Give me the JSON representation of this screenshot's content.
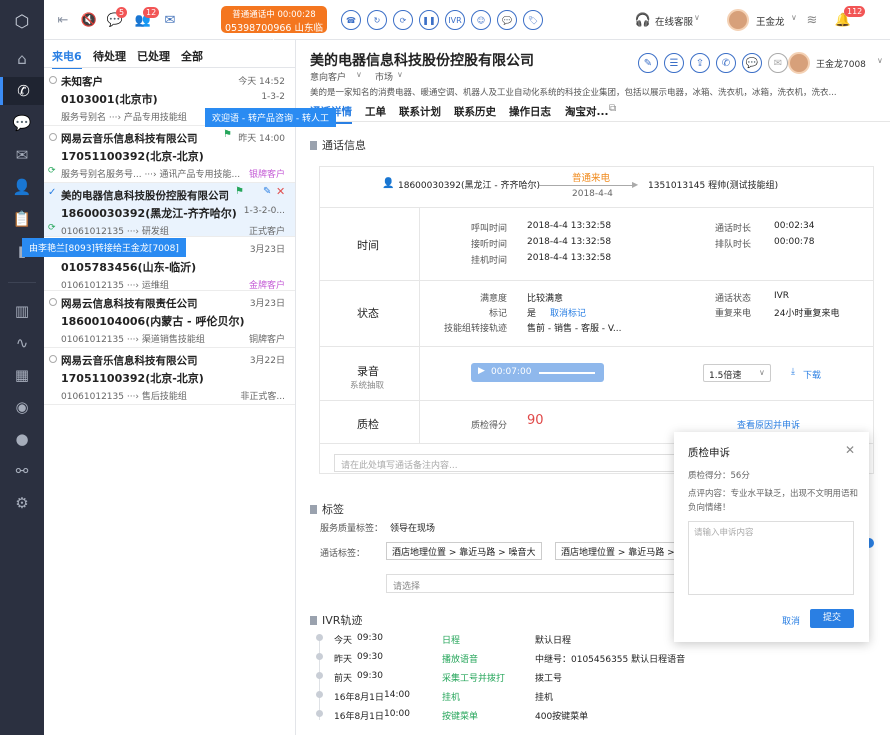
{
  "top": {
    "badge_msg": "5",
    "badge_user": "12",
    "call_status": "普通通话中 00:00:28",
    "call_number": "05398700966 山东临沂",
    "ivr_label": "IVR",
    "service_status": "在线客服",
    "agent_name": "王金龙",
    "notif_badge": "112"
  },
  "list": {
    "tabs": [
      "来电6",
      "待处理",
      "已处理",
      "全部"
    ],
    "calls": [
      {
        "name": "未知客户",
        "time": "今天 14:52",
        "number": "0103001(北京市)",
        "ivr": "1-3-2",
        "line": "服务号别名 ···› 产品专用技能组",
        "status": ""
      },
      {
        "name": "网易云音乐信息科技有限公司",
        "time": "昨天 14:00",
        "number": "17051100392(北京-北京)",
        "ivr": "",
        "line": "服务号别名服务号... ···› 通讯产品专用技能...",
        "status": "银牌客户"
      },
      {
        "name": "美的电器信息科技股份控股有限公司",
        "time": "",
        "number": "18600030392(黑龙江-齐齐哈尔)",
        "ivr": "1-3-2-0...",
        "line": "01061012135 ···› 研发组",
        "status": "正式客户"
      },
      {
        "name": "",
        "time": "3月23日",
        "number": "0105783456(山东-临沂)",
        "ivr": "",
        "line": "01061012135 ···› 运维组",
        "status": "金牌客户"
      },
      {
        "name": "网易云信息科技有限责任公司",
        "time": "3月23日",
        "number": "18600104006(内蒙古 - 呼伦贝尔)",
        "ivr": "",
        "line": "01061012135 ···› 渠道销售技能组",
        "status": "铜牌客户"
      },
      {
        "name": "网易云音乐信息科技有限公司",
        "time": "3月22日",
        "number": "17051100392(北京-北京)",
        "ivr": "",
        "line": "01061012135 ···› 售后技能组",
        "status": "非正式客..."
      }
    ],
    "tip1": "欢迎语 - 转产品咨询 - 转人工",
    "tip2": "由李艳兰[8093]转接给王金龙[7008]"
  },
  "detail": {
    "company": "美的电器信息科技股份控股有限公司",
    "intent": "意向客户",
    "market": "市场",
    "desc": "美的是一家知名的消费电器、暖通空调、机器人及工业自动化系统的科技企业集团，包括以展示电器，冰箱、洗衣机，冰箱，洗衣机，洗衣...",
    "agent": "王金龙7008",
    "tabs": [
      "通话详情",
      "工单",
      "联系计划",
      "联系历史",
      "操作日志",
      "淘宝对..."
    ],
    "sec_call": "通话信息",
    "caller": "18600030392(黑龙江 - 齐齐哈尔)",
    "call_type": "普通来电",
    "call_date": "2018-4-4",
    "callee": "1351013145 程帅(测试技能组)",
    "time_label": "时间",
    "times": [
      [
        "呼叫时间",
        "2018-4-4 13:32:58"
      ],
      [
        "接听时间",
        "2018-4-4 13:32:58"
      ],
      [
        "挂机时间",
        "2018-4-4 13:32:58"
      ]
    ],
    "durs": [
      [
        "通话时长",
        "00:02:34"
      ],
      [
        "排队时长",
        "00:00:78"
      ]
    ],
    "state_label": "状态",
    "sat_label": "满意度",
    "sat_val": "比较满意",
    "mark_label": "标记",
    "mark_val": "是",
    "mark_cancel": "取消标记",
    "route_label": "技能组转接轨迹",
    "route_val": "售前 - 销售 - 客服 - V...",
    "cstate_label": "通话状态",
    "cstate_val": "IVR",
    "repeat_label": "重复来电",
    "repeat_val": "24小时重复来电",
    "rec_label": "录音",
    "rec_sub": "系统抽取",
    "rec_time": "00:07:00",
    "speed": "1.5倍速",
    "download": "下载",
    "qc_label": "质检",
    "qc_score_label": "质检得分",
    "qc_score": "90",
    "appeal_link": "查看原因并申诉",
    "note_ph": "请在此处填写通话备注内容...",
    "sec_tag": "标签",
    "svc_tag_label": "服务质量标签：",
    "svc_tag_val": "领导在现场",
    "call_tag_label": "通话标签：",
    "tags": [
      "酒店地理位置 > 靠近马路 > 噪音大",
      "酒店地理位置 > 靠近马路 > 噪"
    ],
    "select_ph": "请选择",
    "sec_ivr": "IVR轨迹",
    "ivr": [
      [
        "今天",
        "09:30",
        "日程",
        "默认日程"
      ],
      [
        "昨天",
        "09:30",
        "播放语音",
        "中继号：0105456355 默认日程语音"
      ],
      [
        "前天",
        "09:30",
        "采集工号并拨打",
        "拨工号"
      ],
      [
        "16年8月1日",
        "14:00",
        "挂机",
        "挂机"
      ],
      [
        "16年8月1日",
        "10:00",
        "按键菜单",
        "400按键菜单"
      ]
    ]
  },
  "dialog": {
    "title": "质检申诉",
    "score": "质检得分：56分",
    "comment": "点评内容：专业水平缺乏，出现不文明用语和负向情绪！",
    "ph": "请输入申诉内容",
    "cancel": "取消",
    "submit": "提交"
  },
  "colors": {
    "accent": "#2a7fe3",
    "call_orange": "#f4761f",
    "badge_red": "#f25555",
    "sidebar": "#2b3040"
  }
}
